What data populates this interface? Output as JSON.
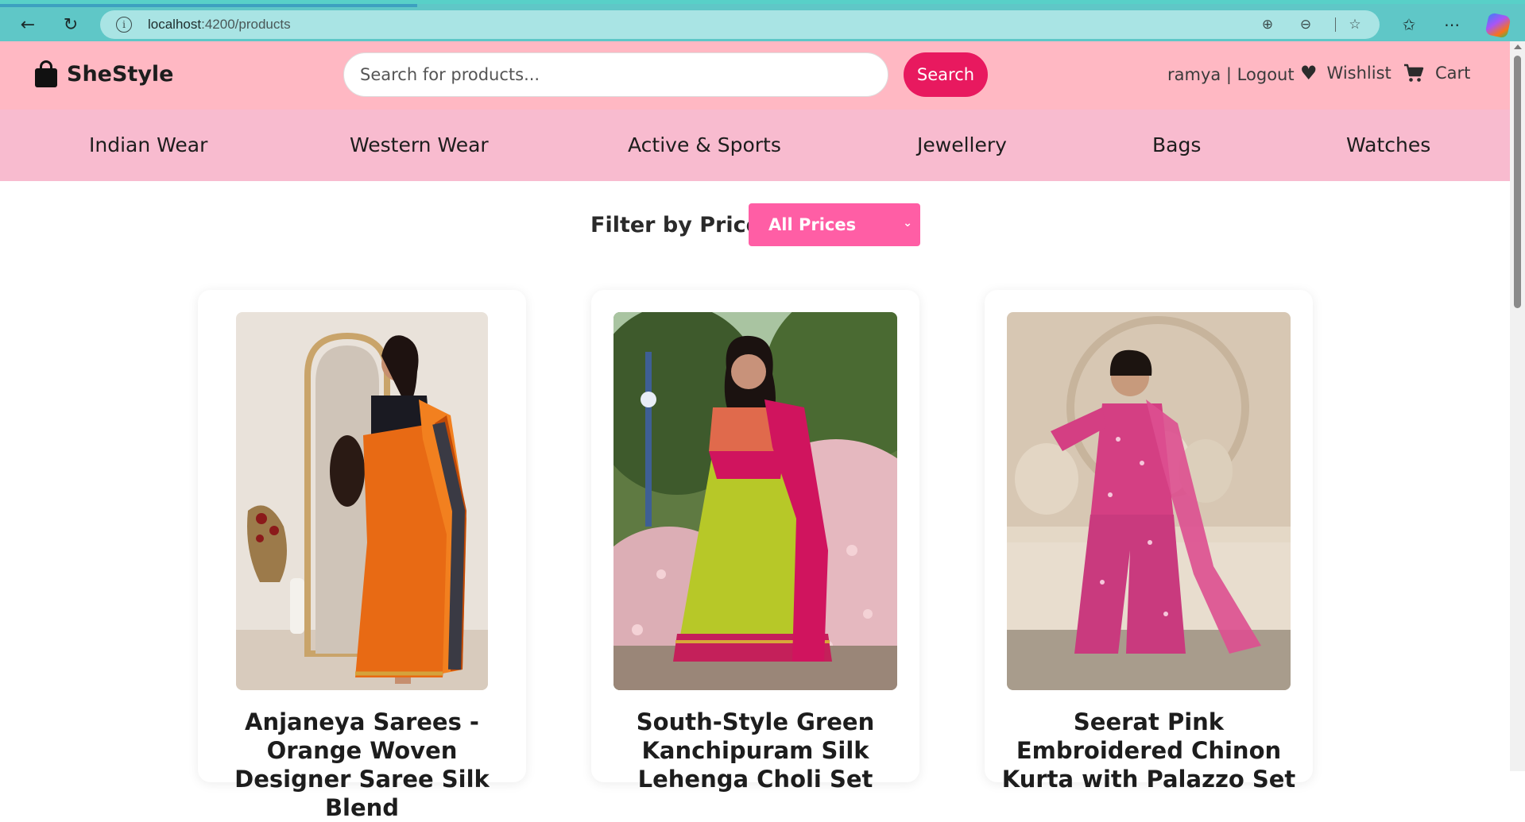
{
  "browser": {
    "url_host": "localhost",
    "url_path": ":4200/products",
    "back_icon": "←",
    "reload_icon": "↻"
  },
  "header": {
    "logo_text": "SheStyle",
    "search_placeholder": "Search for products...",
    "search_button": "Search",
    "user_links": "ramya | Logout",
    "wishlist": "Wishlist",
    "cart": "Cart"
  },
  "categories": [
    "Indian Wear",
    "Western Wear",
    "Active & Sports",
    "Jewellery",
    "Bags",
    "Watches"
  ],
  "filter": {
    "label": "Filter by Price:",
    "selected": "All Prices"
  },
  "products": [
    {
      "title": "Anjaneya Sarees - Orange Woven Designer Saree Silk Blend"
    },
    {
      "title": "South-Style Green Kanchipuram Silk Lehenga Choli Set"
    },
    {
      "title": "Seerat Pink Embroidered Chinon Kurta with Palazzo Set"
    }
  ],
  "colors": {
    "header_bg": "#ffb8c3",
    "nav_bg": "#f8bbcf",
    "accent": "#e8195f",
    "filter_bg": "#ff5ea5",
    "browser_bar": "#5fc7c7"
  }
}
